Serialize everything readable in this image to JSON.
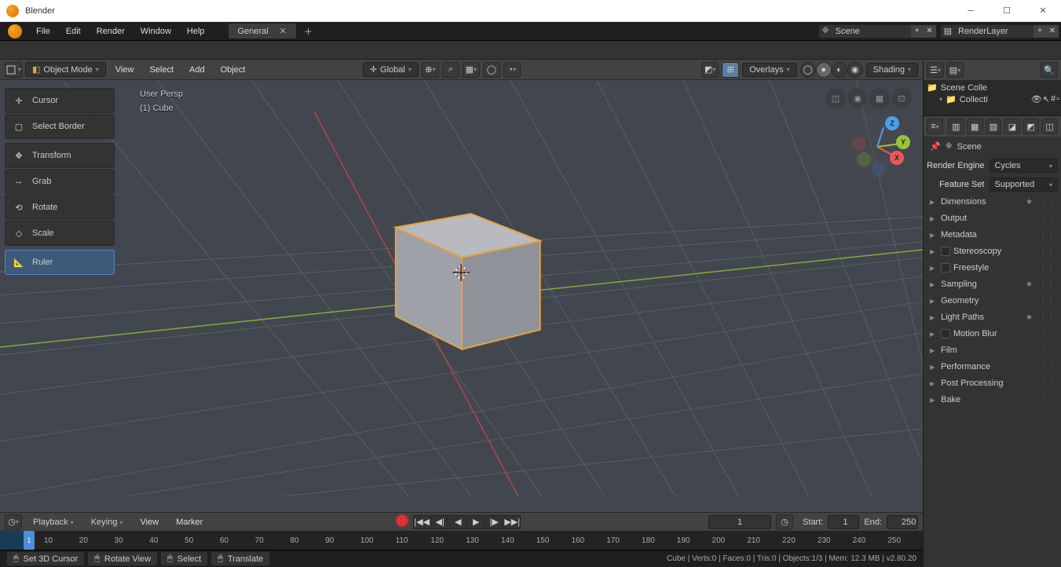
{
  "app": {
    "title": "Blender"
  },
  "topmenu": {
    "items": [
      "File",
      "Edit",
      "Render",
      "Window",
      "Help"
    ],
    "tab": "General"
  },
  "scene": {
    "name": "Scene",
    "layer": "RenderLayer"
  },
  "viewport": {
    "mode": "Object Mode",
    "menus": [
      "View",
      "Select",
      "Add",
      "Object"
    ],
    "orientation": "Global",
    "overlays": "Overlays",
    "shading": "Shading",
    "persp": "User Persp",
    "active": "(1) Cube"
  },
  "tools": [
    {
      "id": "cursor",
      "label": "Cursor"
    },
    {
      "id": "select-border",
      "label": "Select Border"
    },
    {
      "id": "transform",
      "label": "Transform"
    },
    {
      "id": "grab",
      "label": "Grab"
    },
    {
      "id": "rotate",
      "label": "Rotate"
    },
    {
      "id": "scale",
      "label": "Scale"
    },
    {
      "id": "ruler",
      "label": "Ruler"
    }
  ],
  "timeline": {
    "playback": "Playback",
    "keying": "Keying",
    "view": "View",
    "marker": "Marker",
    "current": 1,
    "start_label": "Start:",
    "start": 1,
    "end_label": "End:",
    "end": 250,
    "ticks": [
      10,
      20,
      30,
      40,
      50,
      60,
      70,
      80,
      90,
      100,
      110,
      120,
      130,
      140,
      150,
      160,
      170,
      180,
      190,
      200,
      210,
      220,
      230,
      240,
      250
    ]
  },
  "statusbar": {
    "items": [
      "Set 3D Cursor",
      "Rotate View",
      "Select",
      "Translate"
    ],
    "stats": "Cube | Verts:0 | Faces:0 | Tris:0 | Objects:1/3 | Mem: 12.3 MB | v2.80.20"
  },
  "outliner": {
    "root": "Scene Colle",
    "child": "Collecti"
  },
  "props": {
    "context": "Scene",
    "engine_label": "Render Engine",
    "engine": "Cycles",
    "feature_label": "Feature Set",
    "feature": "Supported",
    "panels": [
      {
        "label": "Dimensions",
        "star": true
      },
      {
        "label": "Output"
      },
      {
        "label": "Metadata"
      },
      {
        "label": "Stereoscopy",
        "checkbox": true
      },
      {
        "label": "Freestyle",
        "checkbox": true
      },
      {
        "label": "Sampling",
        "star": true
      },
      {
        "label": "Geometry"
      },
      {
        "label": "Light Paths",
        "star": true
      },
      {
        "label": "Motion Blur",
        "checkbox": true
      },
      {
        "label": "Film"
      },
      {
        "label": "Performance"
      },
      {
        "label": "Post Processing"
      },
      {
        "label": "Bake"
      }
    ]
  },
  "gizmo": {
    "x": "X",
    "y": "Y",
    "z": "Z"
  }
}
